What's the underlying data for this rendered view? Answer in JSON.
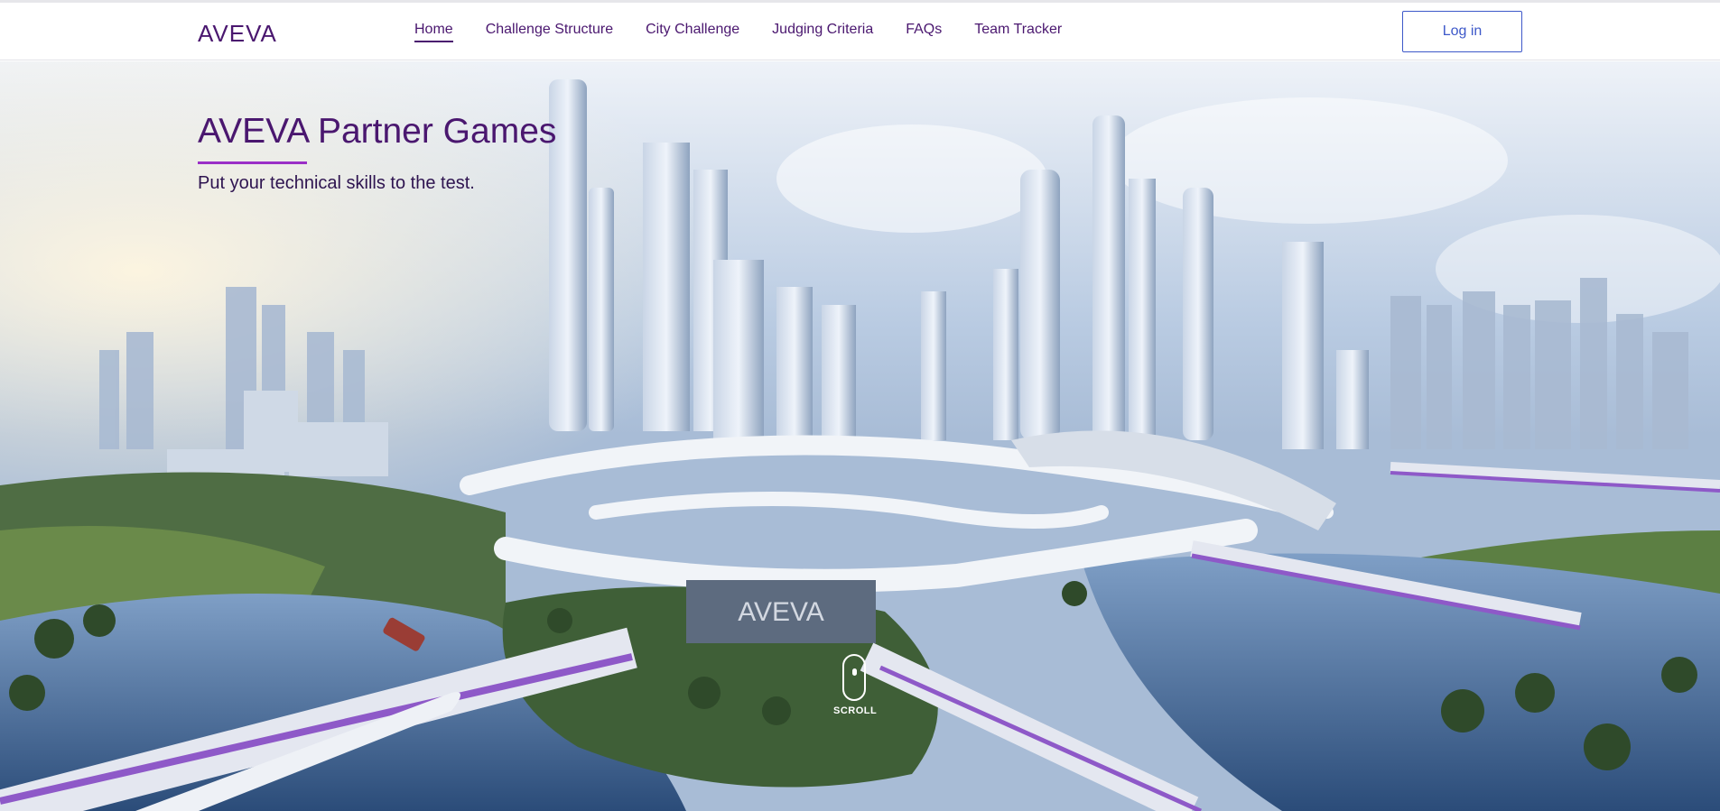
{
  "brand": {
    "logo_text": "AVEVA"
  },
  "nav": {
    "items": [
      {
        "label": "Home",
        "active": true
      },
      {
        "label": "Challenge Structure",
        "active": false
      },
      {
        "label": "City Challenge",
        "active": false
      },
      {
        "label": "Judging Criteria",
        "active": false
      },
      {
        "label": "FAQs",
        "active": false
      },
      {
        "label": "Team Tracker",
        "active": false
      }
    ],
    "login_label": "Log in"
  },
  "hero": {
    "title": "AVEVA Partner Games",
    "subtitle": "Put your technical skills to the test.",
    "building_sign": "AVEVA",
    "scroll_label": "SCROLL"
  },
  "colors": {
    "brand_purple": "#4a176f",
    "accent_purple": "#9b2fc7",
    "login_blue": "#3d58c9"
  },
  "icons": {
    "scroll": "mouse-scroll-icon"
  }
}
